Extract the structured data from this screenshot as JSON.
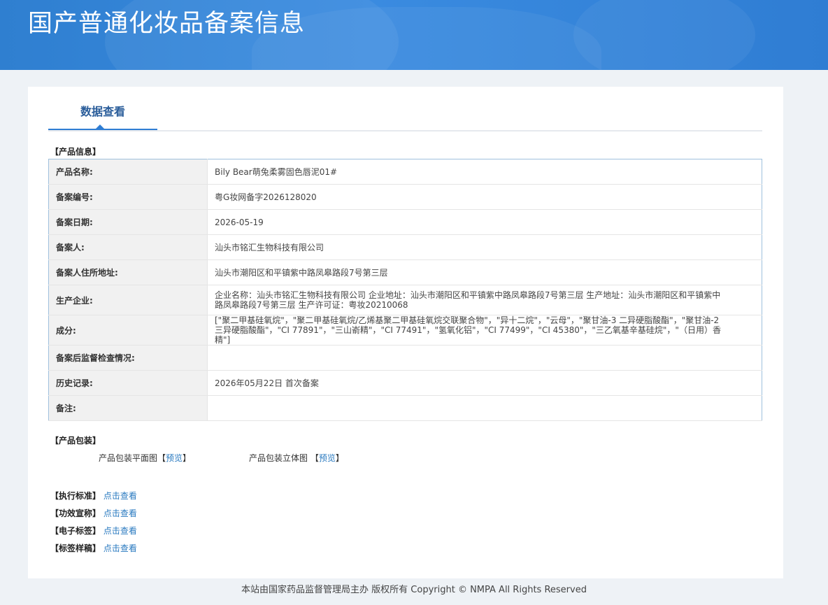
{
  "header": {
    "title": "国产普通化妆品备案信息"
  },
  "tabs": [
    {
      "label": "数据查看"
    }
  ],
  "product_info": {
    "section_title": "【产品信息】",
    "rows": [
      {
        "label": "产品名称:",
        "value": "Bily Bear萌兔柔雾固色唇泥01#"
      },
      {
        "label": "备案编号:",
        "value": "粤G妆网备字2026128020"
      },
      {
        "label": "备案日期:",
        "value": "2026-05-19"
      },
      {
        "label": "备案人:",
        "value": "汕头市铭汇生物科技有限公司"
      },
      {
        "label": "备案人住所地址:",
        "value": "汕头市潮阳区和平镇紫中路凤皋路段7号第三层"
      },
      {
        "label": "生产企业:",
        "value": "企业名称：汕头市铭汇生物科技有限公司 企业地址：汕头市潮阳区和平镇紫中路凤皋路段7号第三层 生产地址：汕头市潮阳区和平镇紫中路凤皋路段7号第三层 生产许可证：粤妆20210068"
      },
      {
        "label": "成分:",
        "value": "[\"聚二甲基硅氧烷\"，\"聚二甲基硅氧烷/乙烯基聚二甲基硅氧烷交联聚合物\"，\"异十二烷\"，\"云母\"，\"聚甘油-3 二异硬脂酸酯\"，\"聚甘油-2 三异硬脂酸酯\"，\"CI 77891\"，\"三山嵛精\"，\"CI 77491\"，\"氢氧化铝\"，\"CI 77499\"，\"CI 45380\"，\"三乙氧基辛基硅烷\"，\"（日用）香精\"]"
      },
      {
        "label": "备案后监督检查情况:",
        "value": ""
      },
      {
        "label": "历史记录:",
        "value": "2026年05月22日 首次备案"
      },
      {
        "label": "备注:",
        "value": ""
      }
    ]
  },
  "packaging": {
    "section_title": "【产品包装】",
    "flat_label": "产品包装平面图",
    "flat_link": "预览",
    "solid_label": "产品包装立体图",
    "solid_link": "预览"
  },
  "links": [
    {
      "label": "【执行标准】",
      "link": "点击查看"
    },
    {
      "label": "【功效宣称】",
      "link": "点击查看"
    },
    {
      "label": "【电子标签】",
      "link": "点击查看"
    },
    {
      "label": "【标签样稿】",
      "link": "点击查看"
    }
  ],
  "footer": {
    "text": "本站由国家药品监督管理局主办 版权所有 Copyright © NMPA All Rights Reserved"
  },
  "colors": {
    "header_blue": "#2f7fd0",
    "accent_blue": "#2f7dd3",
    "link_blue": "#2a7ac0"
  }
}
